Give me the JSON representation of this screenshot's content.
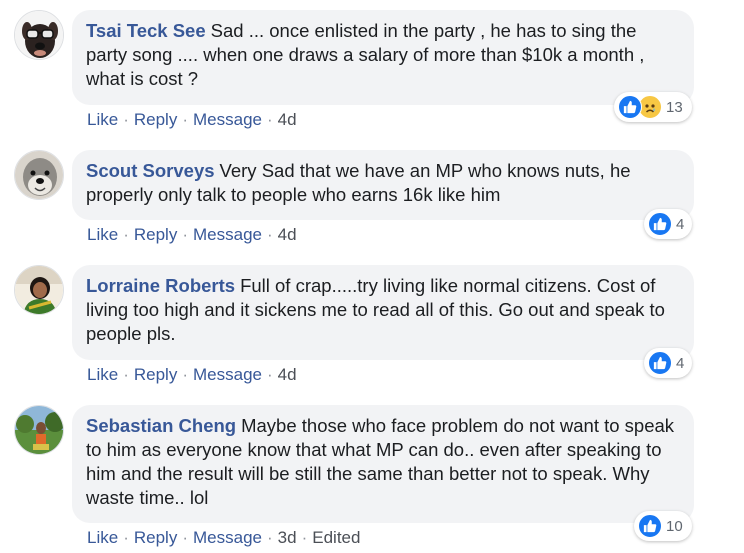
{
  "comments": [
    {
      "author": "Tsai Teck See",
      "text": "Sad ... once enlisted in the party , he has to sing the party song .... when one draws a salary of more than $10k a month , what is cost ?",
      "reactions": [
        "like-icon",
        "sad-icon"
      ],
      "reaction_count": "13",
      "actions": [
        "Like",
        "Reply",
        "Message"
      ],
      "time": "4d",
      "edited": ""
    },
    {
      "author": "Scout Sorveys",
      "text": "Very Sad that we have an MP who knows nuts, he properly only talk to people who earns 16k like him",
      "reactions": [
        "like-icon"
      ],
      "reaction_count": "4",
      "actions": [
        "Like",
        "Reply",
        "Message"
      ],
      "time": "4d",
      "edited": ""
    },
    {
      "author": "Lorraine Roberts",
      "text": "Full of crap.....try living like normal citizens. Cost of living too high and it sickens me to read all of this. Go out and speak to people pls.",
      "reactions": [
        "like-icon"
      ],
      "reaction_count": "4",
      "actions": [
        "Like",
        "Reply",
        "Message"
      ],
      "time": "4d",
      "edited": ""
    },
    {
      "author": "Sebastian Cheng",
      "text": "Maybe those who face problem do not want to speak to him as everyone know that what MP can do.. even after speaking to him and the result will be still the same than better not to speak. Why waste time.. lol",
      "reactions": [
        "like-icon"
      ],
      "reaction_count": "10",
      "actions": [
        "Like",
        "Reply",
        "Message"
      ],
      "time": "3d",
      "edited": "Edited"
    }
  ],
  "colors": {
    "author_link": "#385898",
    "bubble_bg": "#f2f3f5",
    "like_blue": "#1877f2",
    "sad_yellow": "#f7c744",
    "meta_gray": "#606770"
  }
}
